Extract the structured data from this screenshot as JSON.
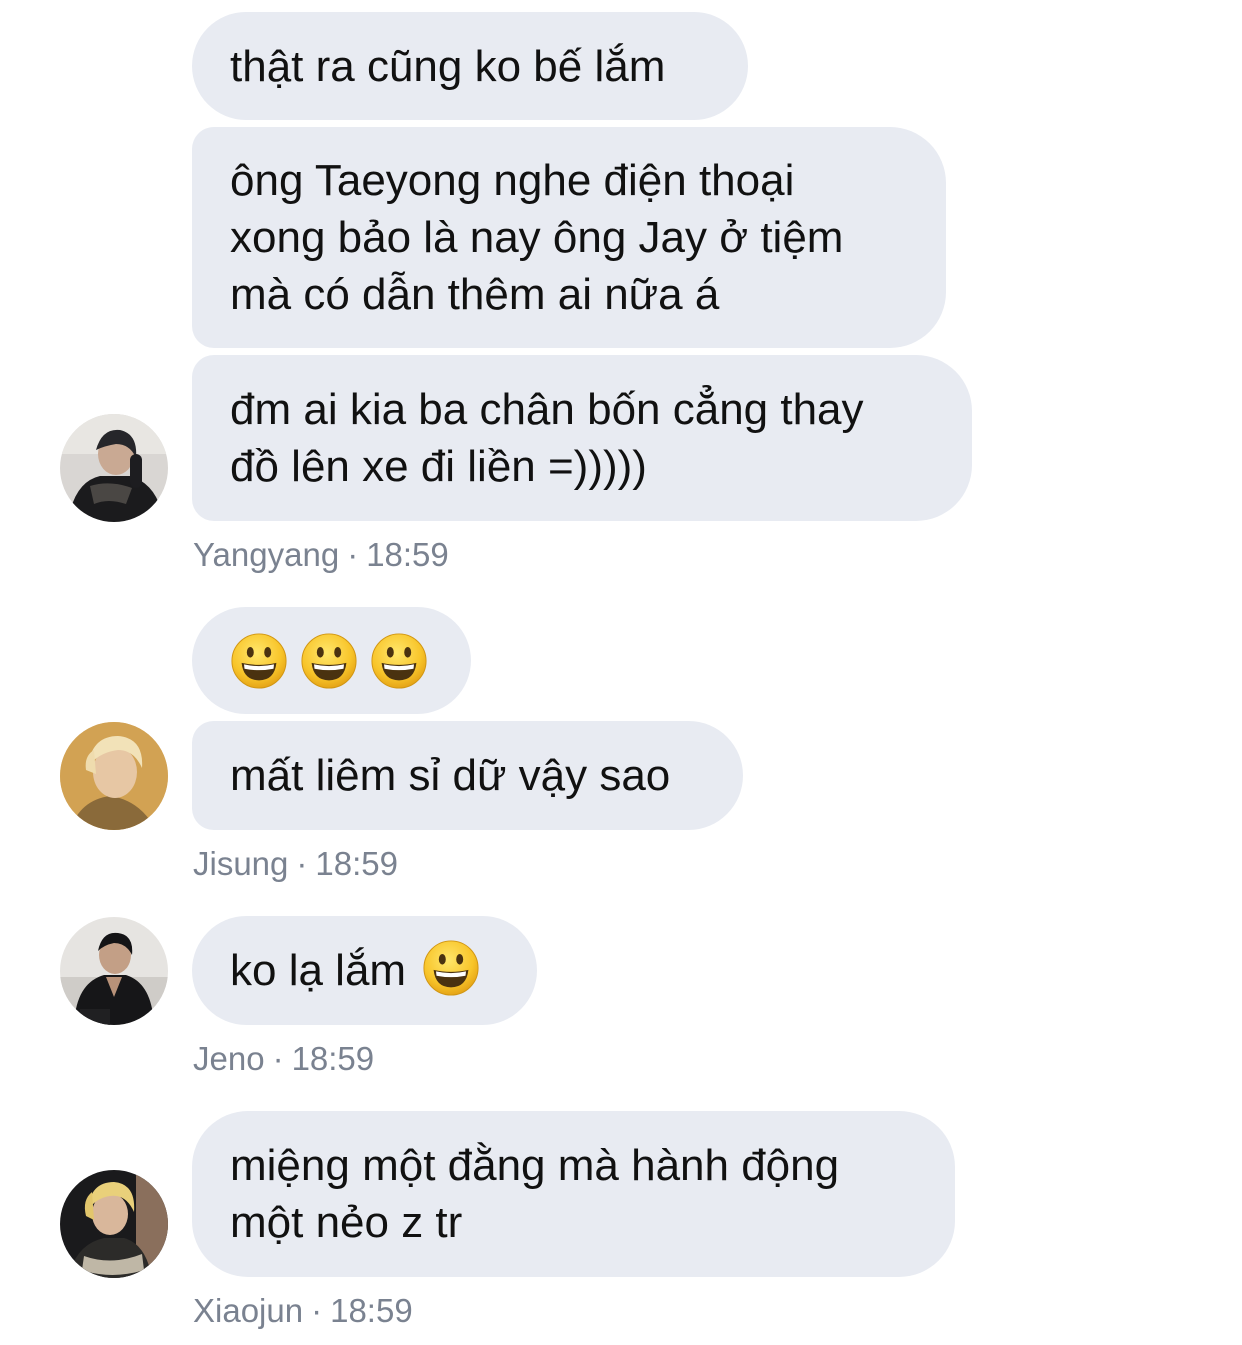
{
  "messages": [
    {
      "lines": [
        "thật ra cũng ko bế lắm"
      ]
    },
    {
      "lines": [
        "ông Taeyong nghe điện thoại",
        "xong bảo là nay ông Jay ở tiệm",
        "mà có dẫn thêm ai nữa á"
      ]
    },
    {
      "lines": [
        "đm ai kia ba chân bốn cẳng thay",
        "đồ lên xe đi liền =)))))"
      ]
    },
    {
      "emoji_count": 3,
      "emoji": "grinning-face"
    },
    {
      "lines": [
        "mất liêm sỉ dữ vậy sao"
      ]
    },
    {
      "lines": [
        "ko lạ lắm"
      ],
      "trailing_emoji": "grinning-face"
    },
    {
      "lines": [
        "miệng một đằng mà hành động",
        "một nẻo z tr"
      ]
    }
  ],
  "senders": [
    {
      "name": "Yangyang",
      "time": "18:59"
    },
    {
      "name": "Jisung",
      "time": "18:59"
    },
    {
      "name": "Jeno",
      "time": "18:59"
    },
    {
      "name": "Xiaojun",
      "time": "18:59"
    }
  ],
  "separator": "·",
  "colors": {
    "bubble": "#e8ebf2",
    "meta_text": "#7a8290",
    "text": "#111111"
  }
}
